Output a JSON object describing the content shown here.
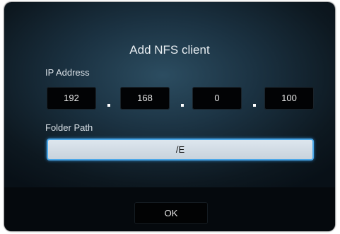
{
  "dialog": {
    "title": "Add NFS client",
    "ip_label": "IP Address",
    "ip_octets": [
      "192",
      "168",
      "0",
      "100"
    ],
    "ip_separator": ".",
    "folder_label": "Folder Path",
    "folder_value": "/E",
    "ok_label": "OK"
  }
}
